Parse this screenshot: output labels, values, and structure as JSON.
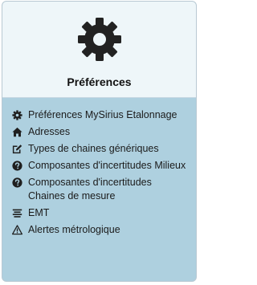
{
  "panel": {
    "title": "Préférences",
    "header_icon": "gear-icon"
  },
  "menu": {
    "items": [
      {
        "label": "Préférences MySirius Etalonnage",
        "icon": "gear-icon"
      },
      {
        "label": "Adresses",
        "icon": "home-icon"
      },
      {
        "label": "Types de chaines génériques",
        "icon": "edit-icon"
      },
      {
        "label": "Composantes d'incertitudes Milieux",
        "icon": "question-circle-icon"
      },
      {
        "label": "Composantes d'incertitudes Chaines de mesure",
        "icon": "question-circle-icon"
      },
      {
        "label": "EMT",
        "icon": "text-align-icon"
      },
      {
        "label": "Alertes métrologique",
        "icon": "warning-icon"
      }
    ]
  },
  "colors": {
    "header_bg": "#eef6f9",
    "body_bg": "#aed0df",
    "icon": "#1f1f1f"
  }
}
